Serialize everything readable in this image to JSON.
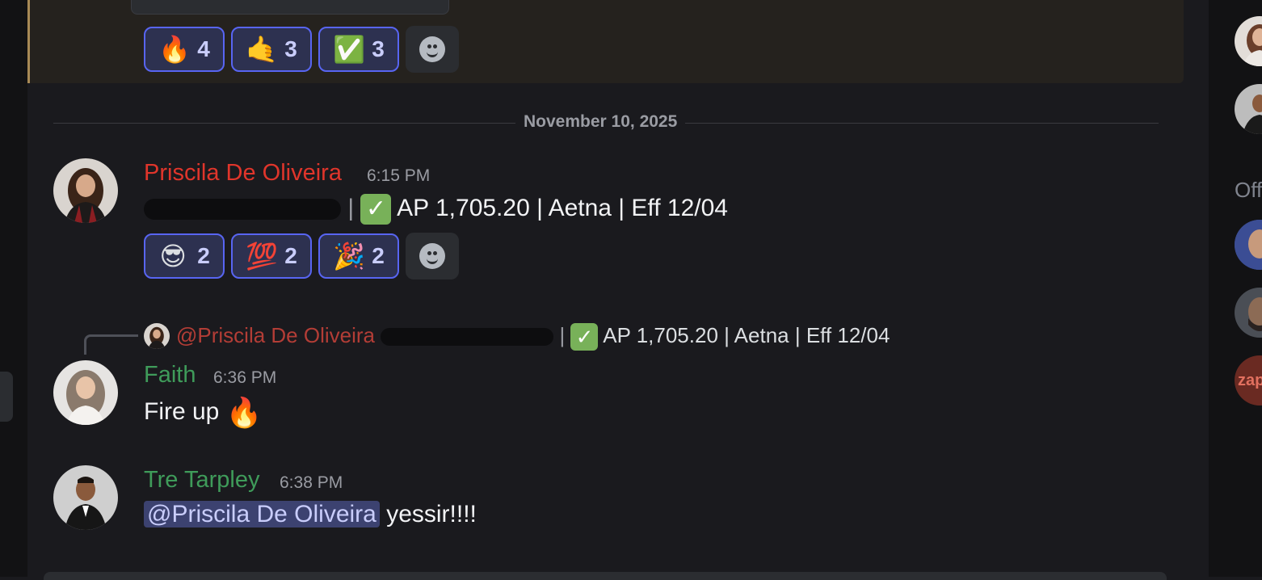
{
  "top_reactions": [
    {
      "emoji": "🔥",
      "count": "4"
    },
    {
      "emoji": "🤙",
      "count": "3"
    },
    {
      "emoji": "✅",
      "count": "3"
    }
  ],
  "date_divider": "November 10, 2025",
  "messages": [
    {
      "author": "Priscila De Oliveira",
      "author_color": "#e0352b",
      "time": "6:15 PM",
      "text_after_redaction": "AP 1,705.20 | Aetna | Eff 12/04",
      "reactions": [
        {
          "emoji": "😎",
          "count": "2"
        },
        {
          "emoji": "💯",
          "count": "2"
        },
        {
          "emoji": "🎉",
          "count": "2"
        }
      ]
    },
    {
      "reply": {
        "mention": "@Priscila De Oliveira",
        "text_after_redaction": "AP 1,705.20 | Aetna | Eff 12/04"
      },
      "author": "Faith",
      "author_color": "#3f9b5a",
      "time": "6:36 PM",
      "text": "Fire up",
      "emoji": "🔥"
    },
    {
      "author": "Tre Tarpley",
      "author_color": "#3f9b5a",
      "time": "6:38 PM",
      "mention": "@Priscila De Oliveira",
      "text": "yessir!!!!"
    }
  ],
  "member_list": {
    "section_label": "Off",
    "zap_label": "zap"
  },
  "colors": {
    "accent": "#5865f2",
    "check_green": "#78b159",
    "highlight_border": "#a88a56"
  }
}
